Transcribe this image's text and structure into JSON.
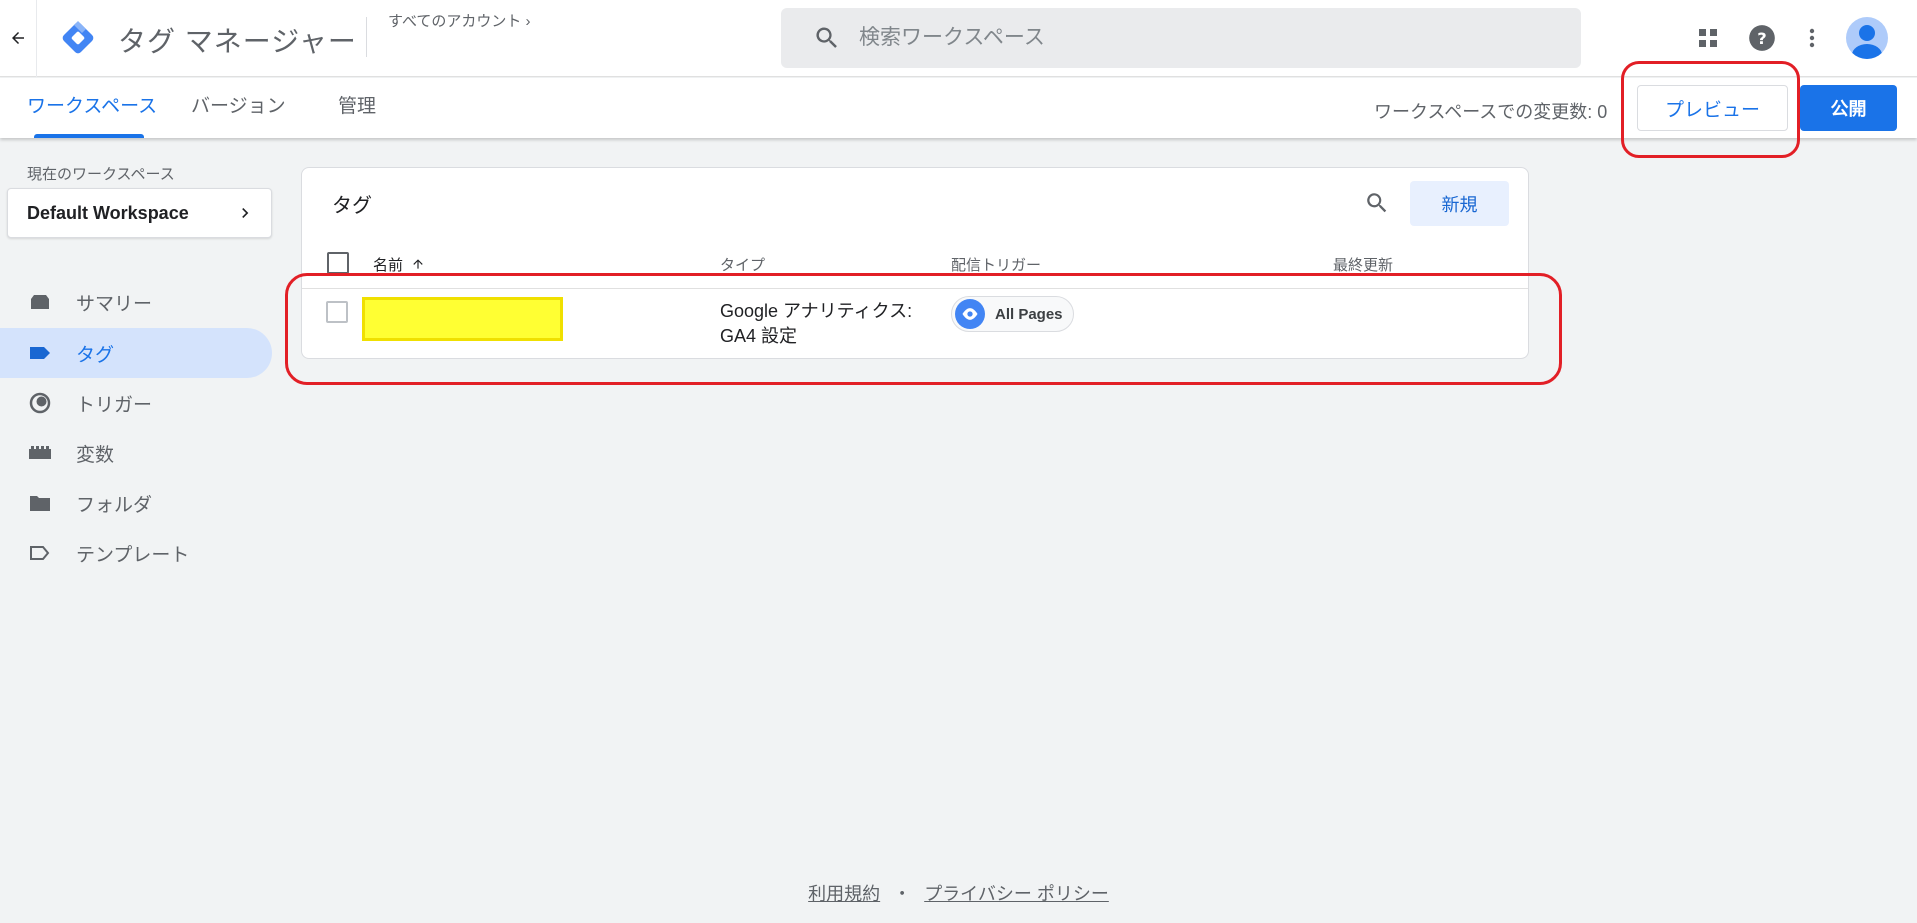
{
  "header": {
    "app_title": "タグ マネージャー",
    "account_link": "すべてのアカウント",
    "search_placeholder": "検索ワークスペース"
  },
  "subnav": {
    "tabs": [
      {
        "label": "ワークスペース",
        "active": true
      },
      {
        "label": "バージョン",
        "active": false
      },
      {
        "label": "管理",
        "active": false
      }
    ],
    "changes_label": "ワークスペースでの変更数: 0",
    "preview_label": "プレビュー",
    "publish_label": "公開"
  },
  "sidebar": {
    "workspace_label": "現在のワークスペース",
    "workspace_name": "Default Workspace",
    "items": [
      {
        "label": "サマリー",
        "icon": "summary-icon",
        "active": false
      },
      {
        "label": "タグ",
        "icon": "tag-icon",
        "active": true
      },
      {
        "label": "トリガー",
        "icon": "trigger-icon",
        "active": false
      },
      {
        "label": "変数",
        "icon": "variables-icon",
        "active": false
      },
      {
        "label": "フォルダ",
        "icon": "folder-icon",
        "active": false
      },
      {
        "label": "テンプレート",
        "icon": "template-icon",
        "active": false
      }
    ]
  },
  "tags_card": {
    "title": "タグ",
    "new_label": "新規",
    "columns": {
      "name": "名前",
      "type": "タイプ",
      "trigger": "配信トリガー",
      "updated": "最終更新"
    },
    "rows": [
      {
        "type_line1": "Google アナリティクス:",
        "type_line2": "GA4 設定",
        "trigger": "All Pages"
      }
    ]
  },
  "footer": {
    "terms": "利用規約",
    "separator": "・",
    "privacy": "プライバシー ポリシー"
  },
  "colors": {
    "accent": "#1a73e8",
    "highlight": "#e21f26",
    "redaction": "#ffff33"
  }
}
